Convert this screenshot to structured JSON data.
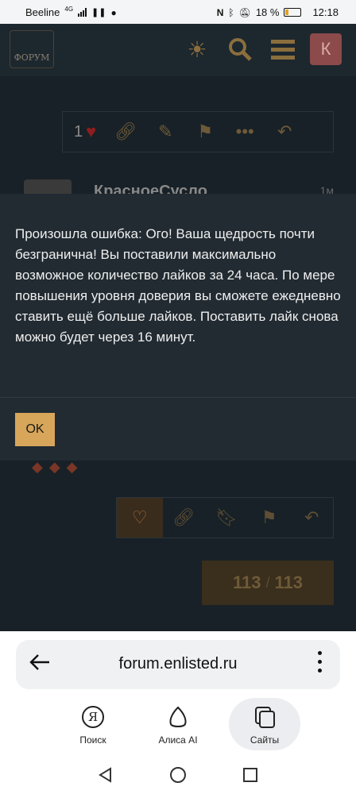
{
  "status_bar": {
    "carrier": "Beeline",
    "network": "4G",
    "battery": "18 %",
    "time": "12:18"
  },
  "forum": {
    "logo_text": "ФОРУМ",
    "avatar_letter": "К",
    "post1_likes": "1",
    "post2_user": "КрасноеСусло",
    "post2_time": "1м",
    "pager_current": "113",
    "pager_sep": "/",
    "pager_total": "113"
  },
  "dialog": {
    "message": "Произошла ошибка: Ого! Ваша щедрость почти безгранична! Вы поставили максимально возможное количество лайков за 24 часа. По мере повышения уровня доверия вы сможете ежедневно ставить ещё больше лайков. Поставить лайк снова можно будет через 16 минут.",
    "ok_label": "OK"
  },
  "browser": {
    "url": "forum.enlisted.ru",
    "tabs": [
      {
        "label": "Поиск",
        "icon": "yandex-icon"
      },
      {
        "label": "Алиса AI",
        "icon": "alice-icon"
      },
      {
        "label": "Сайты",
        "icon": "tabs-icon"
      }
    ]
  },
  "colors": {
    "accent": "#d8a65a",
    "dialog_bg": "#222b32",
    "page_bg": "#182127"
  }
}
